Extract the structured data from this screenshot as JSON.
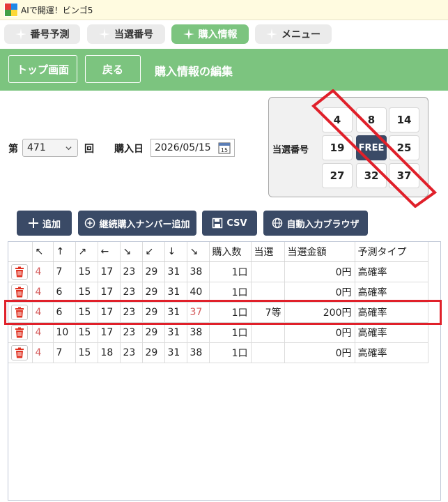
{
  "window": {
    "title": "AIで開運！ビンゴ5"
  },
  "tabs": [
    {
      "label": "番号予測",
      "active": false
    },
    {
      "label": "当選番号",
      "active": false
    },
    {
      "label": "購入情報",
      "active": true
    },
    {
      "label": "メニュー",
      "active": false
    }
  ],
  "header": {
    "top_button": "トップ画面",
    "back_button": "戻る",
    "title": "購入情報の編集"
  },
  "form": {
    "round_prefix": "第",
    "round_value": "471",
    "round_suffix": "回",
    "date_label": "購入日",
    "date_value": "2026/05/15"
  },
  "winning": {
    "label": "当選番号",
    "numbers": [
      "4",
      "8",
      "14",
      "19",
      "FREE",
      "25",
      "27",
      "32",
      "37"
    ]
  },
  "actions": {
    "add": "追加",
    "continuous_add": "継続購入ナンバー追加",
    "csv": "CSV",
    "browser": "自動入力ブラウザ"
  },
  "table": {
    "headers": [
      "",
      "↖",
      "↑",
      "↗",
      "←",
      "↘",
      "↙",
      "↓",
      "↘",
      "購入数",
      "当選",
      "当選金額",
      "予測タイプ"
    ],
    "rows": [
      {
        "nums": [
          "4",
          "7",
          "15",
          "17",
          "23",
          "29",
          "31",
          "38"
        ],
        "count": "1口",
        "prize": "",
        "amount": "0円",
        "type": "高確率"
      },
      {
        "nums": [
          "4",
          "6",
          "15",
          "17",
          "23",
          "29",
          "31",
          "40"
        ],
        "count": "1口",
        "prize": "",
        "amount": "0円",
        "type": "高確率"
      },
      {
        "nums": [
          "4",
          "6",
          "15",
          "17",
          "23",
          "29",
          "31",
          "37"
        ],
        "count": "1口",
        "prize": "7等",
        "amount": "200円",
        "type": "高確率"
      },
      {
        "nums": [
          "4",
          "10",
          "15",
          "17",
          "23",
          "29",
          "31",
          "38"
        ],
        "count": "1口",
        "prize": "",
        "amount": "0円",
        "type": "高確率"
      },
      {
        "nums": [
          "4",
          "7",
          "15",
          "18",
          "23",
          "29",
          "31",
          "38"
        ],
        "count": "1口",
        "prize": "",
        "amount": "0円",
        "type": "高確率"
      }
    ]
  },
  "colors": {
    "green": "#7cc47f",
    "navy": "#3a4a66",
    "red": "#e0202a",
    "match": "#d45a5a"
  }
}
